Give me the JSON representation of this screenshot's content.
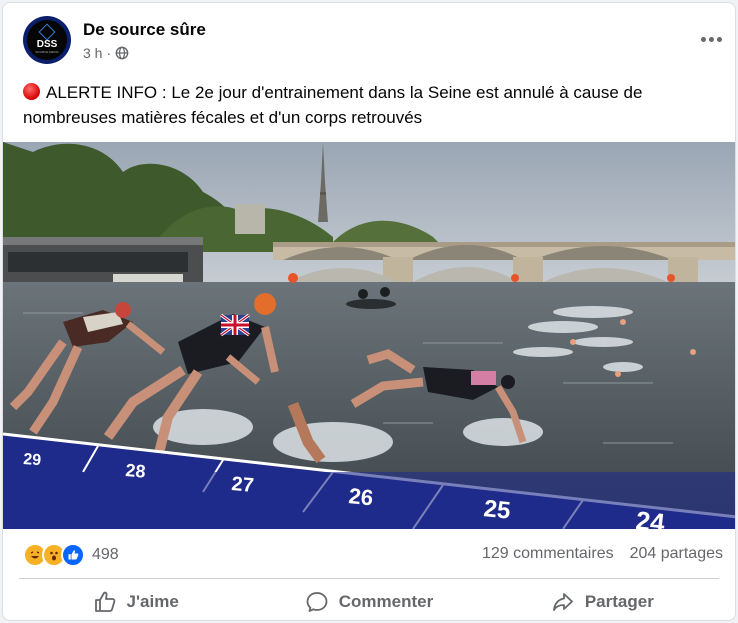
{
  "post": {
    "author": "De source sûre",
    "avatar_text": "DSS",
    "avatar_subtext": "SOURCE MEDIA",
    "time": "3 h",
    "separator": "·",
    "text": "ALERTE INFO : Le 2e jour d'entrainement dans la Seine est annulé à cause de nombreuses matières fécales et d'un corps retrouvés"
  },
  "photo": {
    "lane_numbers": [
      "29",
      "28",
      "27",
      "26",
      "25",
      "24"
    ]
  },
  "stats": {
    "reaction_count": "498",
    "comments": "129 commentaires",
    "shares": "204 partages"
  },
  "actions": {
    "like": "J'aime",
    "comment": "Commenter",
    "share": "Partager"
  },
  "colors": {
    "text_primary": "#050505",
    "text_secondary": "#65676b",
    "like_blue": "#0866ff",
    "pontoon_blue": "#1f2b8a"
  },
  "icons": [
    "globe-icon",
    "more-icon",
    "red-circle-icon",
    "laugh-icon",
    "wow-icon",
    "like-icon",
    "thumbs-up-icon",
    "comment-icon",
    "share-icon"
  ]
}
